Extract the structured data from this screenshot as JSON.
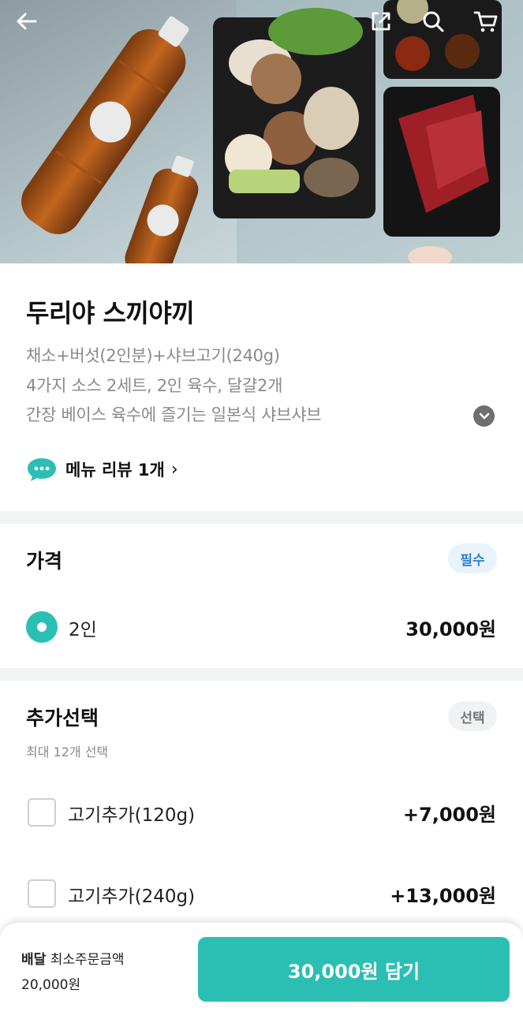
{
  "hero": {
    "image_alt": "sukiyaki meal kit photo",
    "icons": {
      "back": "arrow-left-icon",
      "share": "share-icon",
      "search": "search-icon",
      "cart": "cart-icon"
    }
  },
  "product": {
    "title": "두리야 스끼야끼",
    "description": [
      "채소+버섯(2인분)+샤브고기(240g)",
      "4가지 소스 2세트, 2인 육수, 달걀2개",
      "간장 베이스 육수에 즐기는 일본식 샤브샤브"
    ],
    "review_label": "메뉴 리뷰 1개",
    "review_chevron": "›"
  },
  "price_section": {
    "title": "가격",
    "badge": "필수",
    "options": [
      {
        "label": "2인",
        "price": "30,000원",
        "selected": true
      }
    ]
  },
  "addon_section": {
    "title": "추가선택",
    "badge": "선택",
    "subtitle": "최대 12개 선택",
    "options": [
      {
        "label": "고기추가(120g)",
        "price": "+7,000원",
        "checked": false
      },
      {
        "label": "고기추가(240g)",
        "price": "+13,000원",
        "checked": false
      }
    ]
  },
  "footer": {
    "delivery_label": "배달",
    "min_order_label": "최소주문금액",
    "min_order_amount": "20,000원",
    "cta_label": "30,000원 담기"
  },
  "colors": {
    "accent": "#2bbfb3",
    "required_badge_bg": "#e8f3fb",
    "required_badge_text": "#2f86cf"
  }
}
